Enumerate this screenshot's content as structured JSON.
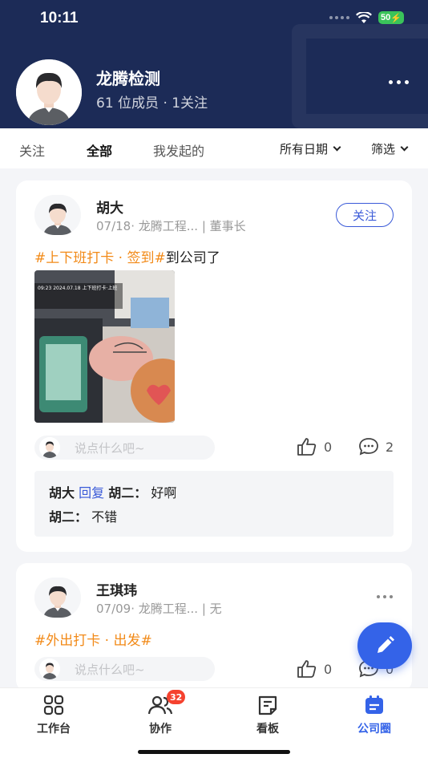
{
  "status_bar": {
    "time": "10:11",
    "battery": "50"
  },
  "group": {
    "name": "龙腾检测",
    "meta": "61 位成员 · 1关注"
  },
  "tabs": [
    {
      "label": "关注"
    },
    {
      "label": "全部",
      "active": true
    },
    {
      "label": "我发起的"
    }
  ],
  "filters": {
    "date": "所有日期",
    "filter": "筛选"
  },
  "posts": [
    {
      "user": "胡大",
      "meta": "07/18· 龙腾工程... | 董事长",
      "follow_label": "关注",
      "tag": "#上下班打卡 · 签到#",
      "text": "到公司了",
      "photo_stamp": "09:23 2024.07.18 上下班打卡·上班",
      "comment_placeholder": "说点什么吧~",
      "likes": "0",
      "comments": "2",
      "replies": [
        {
          "from": "胡大",
          "reply_word": "回复",
          "to": "胡二：",
          "text": "好啊"
        },
        {
          "from": "胡二：",
          "text": "不错"
        }
      ]
    },
    {
      "user": "王琪玮",
      "meta": "07/09· 龙腾工程... | 无",
      "tag": "#外出打卡 · 出发#",
      "comment_placeholder": "说点什么吧~",
      "likes": "0",
      "comments": "0"
    }
  ],
  "bottom_nav": [
    {
      "label": "工作台",
      "icon": "grid-icon"
    },
    {
      "label": "协作",
      "icon": "people-icon",
      "badge": "32"
    },
    {
      "label": "看板",
      "icon": "board-icon"
    },
    {
      "label": "公司圈",
      "icon": "calendar-icon",
      "active": true
    }
  ],
  "colors": {
    "header": "#1c2b57",
    "accent": "#3463e8",
    "tag": "#f28a18",
    "badge": "#f5422f"
  }
}
